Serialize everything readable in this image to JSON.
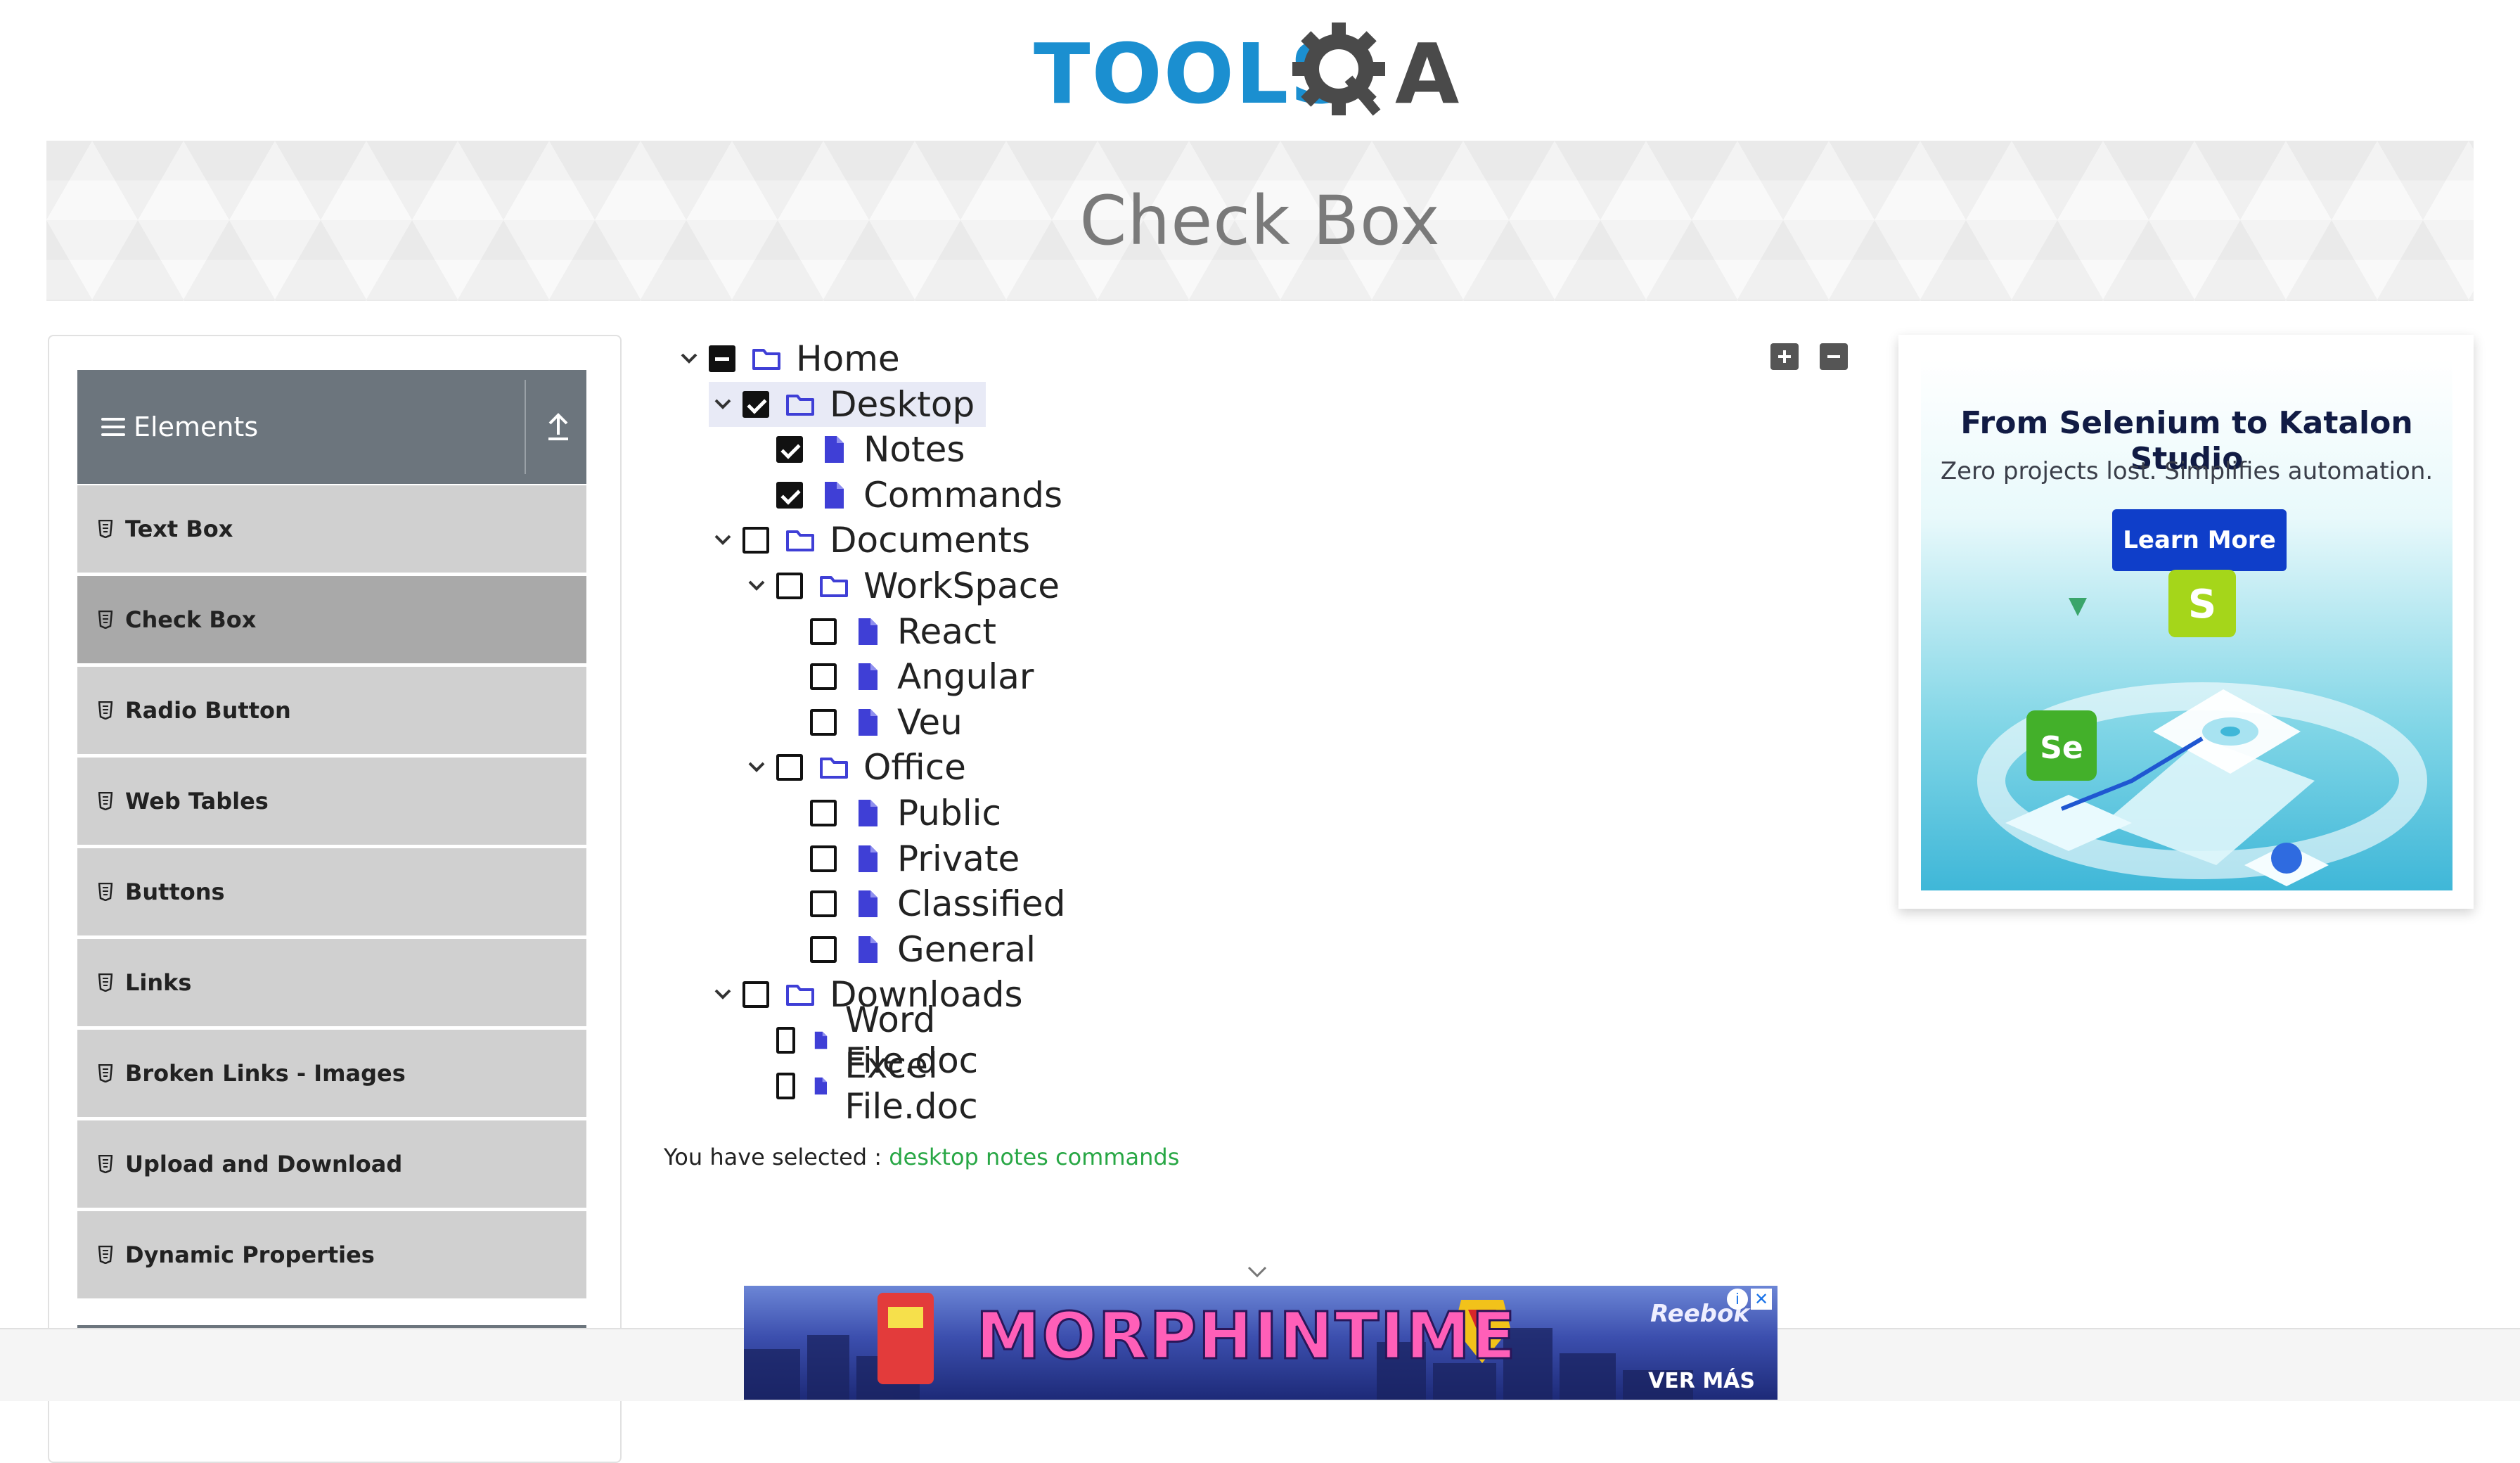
{
  "logo": {
    "tools": "TOOLS",
    "qa_letter": "A"
  },
  "banner": {
    "title": "Check Box"
  },
  "sidebar": {
    "group_title": "Elements",
    "items": [
      {
        "label": "Text Box",
        "active": false
      },
      {
        "label": "Check Box",
        "active": true
      },
      {
        "label": "Radio Button",
        "active": false
      },
      {
        "label": "Web Tables",
        "active": false
      },
      {
        "label": "Buttons",
        "active": false
      },
      {
        "label": "Links",
        "active": false
      },
      {
        "label": "Broken Links - Images",
        "active": false
      },
      {
        "label": "Upload and Download",
        "active": false
      },
      {
        "label": "Dynamic Properties",
        "active": false
      }
    ]
  },
  "tree": {
    "nodes": [
      {
        "label": "Home",
        "type": "folder",
        "state": "half",
        "expanded": true
      },
      {
        "label": "Desktop",
        "type": "folder",
        "state": "checked",
        "expanded": true
      },
      {
        "label": "Notes",
        "type": "file",
        "state": "checked"
      },
      {
        "label": "Commands",
        "type": "file",
        "state": "checked"
      },
      {
        "label": "Documents",
        "type": "folder",
        "state": "unchecked",
        "expanded": true
      },
      {
        "label": "WorkSpace",
        "type": "folder",
        "state": "unchecked",
        "expanded": true
      },
      {
        "label": "React",
        "type": "file",
        "state": "unchecked"
      },
      {
        "label": "Angular",
        "type": "file",
        "state": "unchecked"
      },
      {
        "label": "Veu",
        "type": "file",
        "state": "unchecked"
      },
      {
        "label": "Office",
        "type": "folder",
        "state": "unchecked",
        "expanded": true
      },
      {
        "label": "Public",
        "type": "file",
        "state": "unchecked"
      },
      {
        "label": "Private",
        "type": "file",
        "state": "unchecked"
      },
      {
        "label": "Classified",
        "type": "file",
        "state": "unchecked"
      },
      {
        "label": "General",
        "type": "file",
        "state": "unchecked"
      },
      {
        "label": "Downloads",
        "type": "folder",
        "state": "unchecked",
        "expanded": true
      },
      {
        "label": "Word File.doc",
        "type": "file",
        "state": "unchecked"
      },
      {
        "label": "Excel File.doc",
        "type": "file",
        "state": "unchecked"
      }
    ],
    "expand_all_icon": "plus-square-icon",
    "collapse_all_icon": "minus-square-icon"
  },
  "result": {
    "prefix": "You have selected :",
    "selected": "desktop notes commands"
  },
  "ad_right": {
    "title": "From Selenium to Katalon Studio",
    "subtitle": "Zero projects lost. Simplifies automation.",
    "button": "Learn More",
    "logo_s": "S",
    "logo_se": "Se"
  },
  "ad_bottom": {
    "headline": "MORPHINTIME",
    "brand": "Reebok",
    "cta": "VER MÁS",
    "close": "✕",
    "info": "i"
  },
  "colors": {
    "accent_blue": "#1b8fd0",
    "sidebar_header": "#6c757d",
    "menu_item": "#d0d0d0",
    "menu_item_active": "#a9a9a9",
    "file_icon": "#3f3fd6",
    "selected_text": "#28a745",
    "ad_button": "#0f3ec9"
  }
}
